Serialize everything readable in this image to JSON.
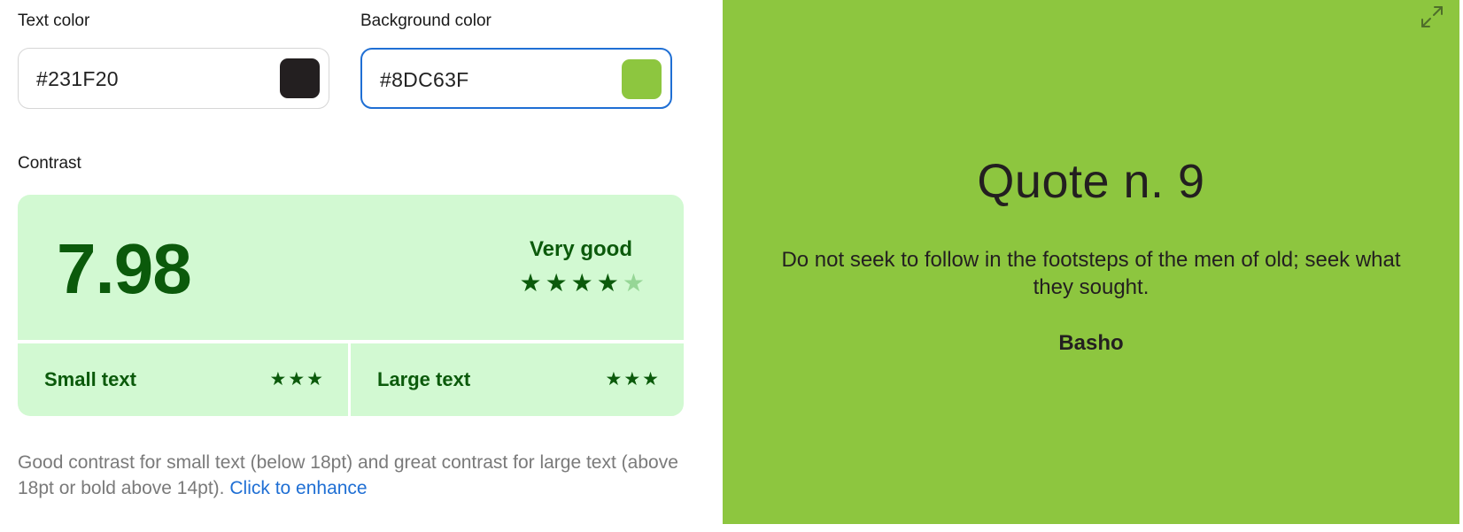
{
  "text_color": {
    "label": "Text color",
    "value": "#231F20",
    "swatch_color": "#231F20"
  },
  "background_color": {
    "label": "Background color",
    "value": "#8DC63F",
    "swatch_color": "#8DC63F"
  },
  "contrast": {
    "label": "Contrast",
    "ratio": "7.98",
    "rating_label": "Very good",
    "rating_stars": 4,
    "rating_max": 5,
    "small_text": {
      "label": "Small text",
      "stars": 3
    },
    "large_text": {
      "label": "Large text",
      "stars": 3
    },
    "description": "Good contrast for small text (below 18pt) and great contrast for large text (above 18pt or bold above 14pt).",
    "enhance_link": "Click to enhance"
  },
  "preview": {
    "icon": "expand-icon",
    "title": "Quote n. 9",
    "quote": "Do not seek to follow in the footsteps of the men of old; seek what they sought.",
    "author": "Basho"
  },
  "colors": {
    "accent": "#1f6fd4",
    "success_dark": "#0b5a0b",
    "success_bg": "#d2f9d2"
  }
}
